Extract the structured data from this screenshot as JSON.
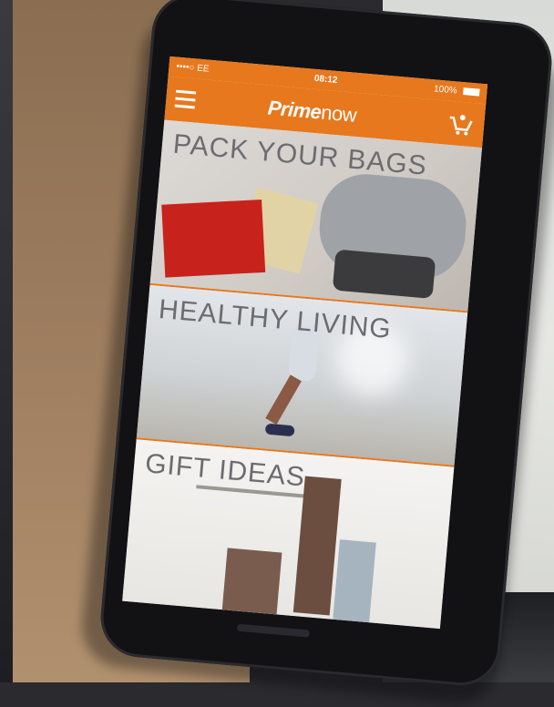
{
  "app": {
    "brand_bold": "Prime",
    "brand_light": "now"
  },
  "statusbar": {
    "carrier": "••••○ EE",
    "time": "08:12",
    "battery": "100%"
  },
  "tiles": [
    {
      "label": "PACK YOUR BAGS"
    },
    {
      "label": "HEALTHY LIVING"
    },
    {
      "label": "GIFT IDEAS"
    }
  ],
  "icons": [
    "menu-icon",
    "cart-icon"
  ],
  "colors": {
    "accent": "#e7781d",
    "label_text": "#6c6c70"
  }
}
